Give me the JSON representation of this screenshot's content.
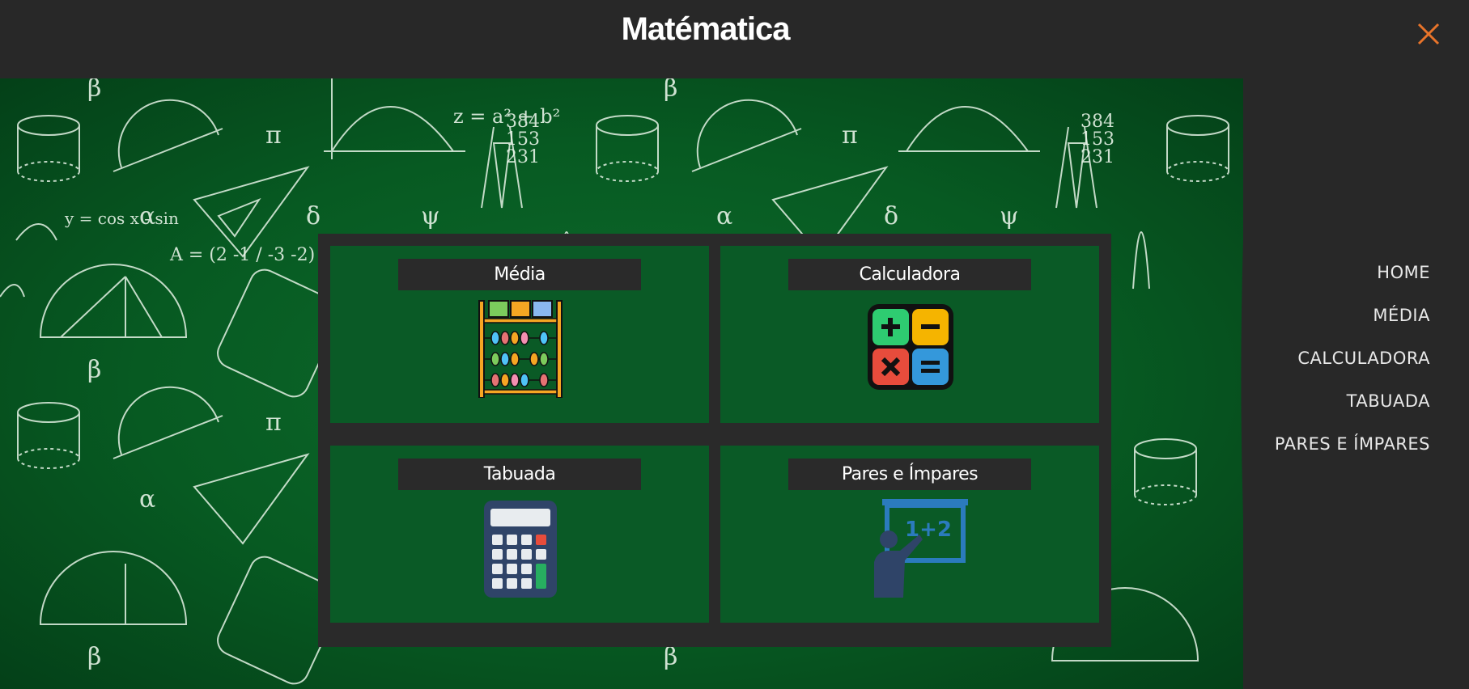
{
  "header": {
    "title": "Matématica"
  },
  "cards": [
    {
      "label": "Média",
      "icon": "abacus-icon"
    },
    {
      "label": "Calculadora",
      "icon": "calculator-operators-icon"
    },
    {
      "label": "Tabuada",
      "icon": "calculator-icon"
    },
    {
      "label": "Pares e Ímpares",
      "icon": "teacher-board-icon"
    }
  ],
  "nav": {
    "items": [
      {
        "label": "HOME"
      },
      {
        "label": "MÉDIA"
      },
      {
        "label": "CALCULADORA"
      },
      {
        "label": "TABUADA"
      },
      {
        "label": "PARES E ÍMPARES"
      }
    ]
  },
  "colors": {
    "background": "#282828",
    "board": "#0a5a26",
    "accent": "#e8742a"
  }
}
